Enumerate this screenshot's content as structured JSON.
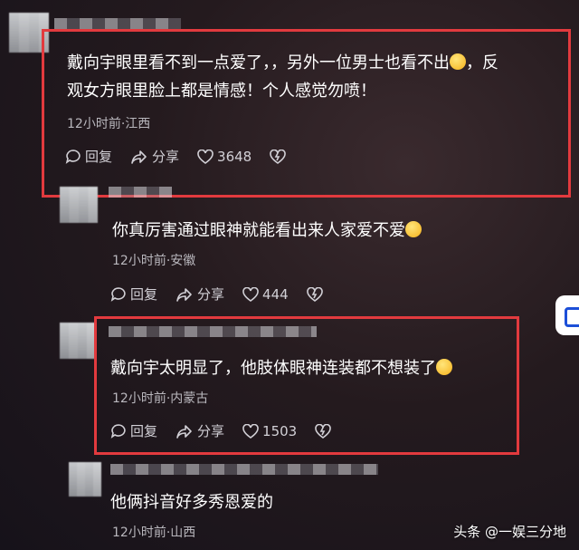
{
  "comments": [
    {
      "line1": "戴向宇眼里看不到一点爱了，，另外一位男士也看不出",
      "line1_tail": "，反",
      "line2": "观女方眼里脸上都是情感！个人感觉勿喷！",
      "meta": "12小时前·江西",
      "reply": "回复",
      "share": "分享",
      "likes": "3648"
    },
    {
      "line1": "你真厉害通过眼神就能看出来人家爱不爱",
      "meta": "12小时前·安徽",
      "reply": "回复",
      "share": "分享",
      "likes": "444"
    },
    {
      "line1": "戴向宇太明显了，他肢体眼神连装都不想装了",
      "meta": "12小时前·内蒙古",
      "reply": "回复",
      "share": "分享",
      "likes": "1503"
    },
    {
      "line1": "他俩抖音好多秀恩爱的",
      "meta": "12小时前·山西"
    }
  ],
  "watermark": "头条 @一娱三分地",
  "colors": {
    "highlight": "#e23a3e",
    "text": "#ffffff",
    "meta": "#b9b7bd"
  },
  "icons": [
    "reply-icon",
    "share-icon",
    "heart-icon",
    "dislike-heart-icon",
    "emoji-icon",
    "side-button-icon"
  ]
}
